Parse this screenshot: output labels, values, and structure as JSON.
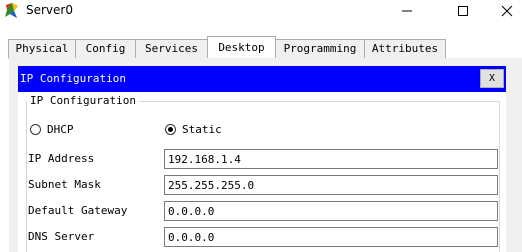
{
  "window": {
    "title": "Server0",
    "app_icon": "packet-tracer-server-icon",
    "controls": {
      "minimize_icon": "minimize-icon",
      "maximize_icon": "maximize-icon",
      "close_icon": "close-icon"
    }
  },
  "tabs": [
    {
      "label": "Physical",
      "active": false
    },
    {
      "label": "Config",
      "active": false
    },
    {
      "label": "Services",
      "active": false
    },
    {
      "label": "Desktop",
      "active": true
    },
    {
      "label": "Programming",
      "active": false
    },
    {
      "label": "Attributes",
      "active": false
    }
  ],
  "ip_configuration": {
    "header_title": "IP Configuration",
    "close_label": "X",
    "group_title": "IP Configuration",
    "dhcp_label": "DHCP",
    "static_label": "Static",
    "mode": "Static",
    "fields": {
      "ip_address": {
        "label": "IP Address",
        "value": "192.168.1.4"
      },
      "subnet_mask": {
        "label": "Subnet Mask",
        "value": "255.255.255.0"
      },
      "default_gateway": {
        "label": "Default Gateway",
        "value": "0.0.0.0"
      },
      "dns_server": {
        "label": "DNS Server",
        "value": "0.0.0.0"
      }
    }
  },
  "colors": {
    "header_bg": "#0000ff",
    "header_text": "#ffffff",
    "content_bg": "#f0f0f0"
  }
}
